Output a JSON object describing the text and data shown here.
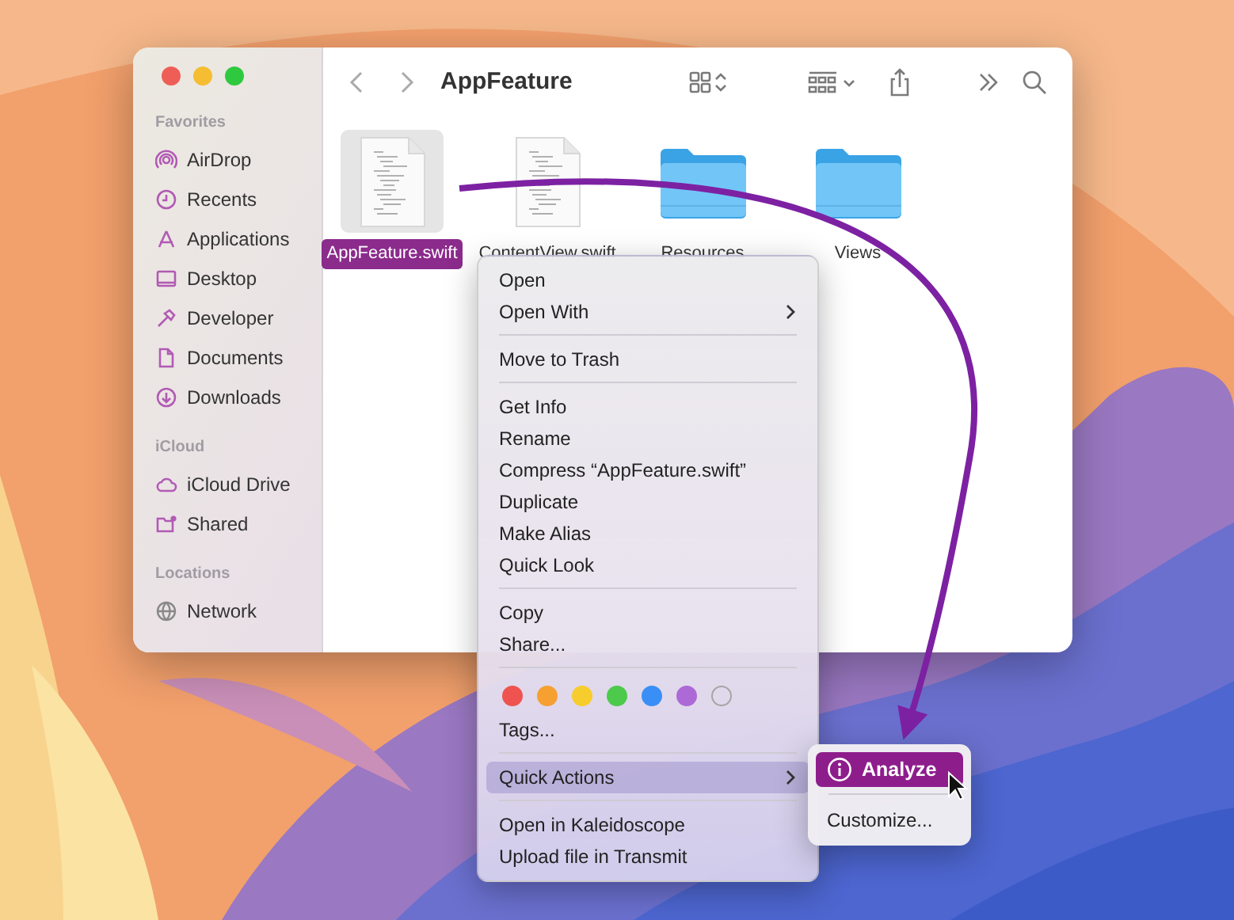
{
  "window": {
    "title": "AppFeature"
  },
  "sidebar": [
    {
      "heading": "Favorites",
      "items": [
        {
          "label": "AirDrop"
        },
        {
          "label": "Recents"
        },
        {
          "label": "Applications"
        },
        {
          "label": "Desktop"
        },
        {
          "label": "Developer"
        },
        {
          "label": "Documents"
        },
        {
          "label": "Downloads"
        }
      ]
    },
    {
      "heading": "iCloud",
      "items": [
        {
          "label": "iCloud Drive"
        },
        {
          "label": "Shared"
        }
      ]
    },
    {
      "heading": "Locations",
      "items": [
        {
          "label": "Network"
        }
      ]
    }
  ],
  "files": [
    {
      "name": "AppFeature.swift",
      "kind": "document",
      "selected": true
    },
    {
      "name": "ContentView.swift",
      "kind": "document",
      "selected": false
    },
    {
      "name": "Resources",
      "kind": "folder",
      "selected": false
    },
    {
      "name": "Views",
      "kind": "folder",
      "selected": false
    }
  ],
  "context_menu": [
    {
      "kind": "item",
      "label": "Open",
      "submenu": false,
      "highlighted": false
    },
    {
      "kind": "item",
      "label": "Open With",
      "submenu": true,
      "highlighted": false
    },
    {
      "kind": "separator"
    },
    {
      "kind": "item",
      "label": "Move to Trash",
      "submenu": false,
      "highlighted": false
    },
    {
      "kind": "separator"
    },
    {
      "kind": "item",
      "label": "Get Info",
      "submenu": false,
      "highlighted": false
    },
    {
      "kind": "item",
      "label": "Rename",
      "submenu": false,
      "highlighted": false
    },
    {
      "kind": "item",
      "label": "Compress “AppFeature.swift”",
      "submenu": false,
      "highlighted": false
    },
    {
      "kind": "item",
      "label": "Duplicate",
      "submenu": false,
      "highlighted": false
    },
    {
      "kind": "item",
      "label": "Make Alias",
      "submenu": false,
      "highlighted": false
    },
    {
      "kind": "item",
      "label": "Quick Look",
      "submenu": false,
      "highlighted": false
    },
    {
      "kind": "separator"
    },
    {
      "kind": "item",
      "label": "Copy",
      "submenu": false,
      "highlighted": false
    },
    {
      "kind": "item",
      "label": "Share...",
      "submenu": false,
      "highlighted": false
    },
    {
      "kind": "separator"
    },
    {
      "kind": "tags",
      "tags": [
        {
          "kind": "filled",
          "color": "#ef5350"
        },
        {
          "kind": "filled",
          "color": "#f5a030"
        },
        {
          "kind": "filled",
          "color": "#f6cd2d"
        },
        {
          "kind": "filled",
          "color": "#4dc94c"
        },
        {
          "kind": "filled",
          "color": "#3a8ff6"
        },
        {
          "kind": "filled",
          "color": "#ad6ad6"
        },
        {
          "kind": "empty",
          "color": "#a5a5a5"
        }
      ]
    },
    {
      "kind": "item",
      "label": "Tags...",
      "submenu": false,
      "highlighted": false
    },
    {
      "kind": "separator"
    },
    {
      "kind": "item",
      "label": "Quick Actions",
      "submenu": true,
      "highlighted": true
    },
    {
      "kind": "separator"
    },
    {
      "kind": "item",
      "label": "Open in Kaleidoscope",
      "submenu": false,
      "highlighted": false
    },
    {
      "kind": "item",
      "label": "Upload file in Transmit",
      "submenu": false,
      "highlighted": false
    }
  ],
  "submenu": [
    {
      "kind": "action",
      "label": "Analyze",
      "selected": true
    },
    {
      "kind": "separator"
    },
    {
      "kind": "item",
      "label": "Customize...",
      "selected": false
    }
  ]
}
